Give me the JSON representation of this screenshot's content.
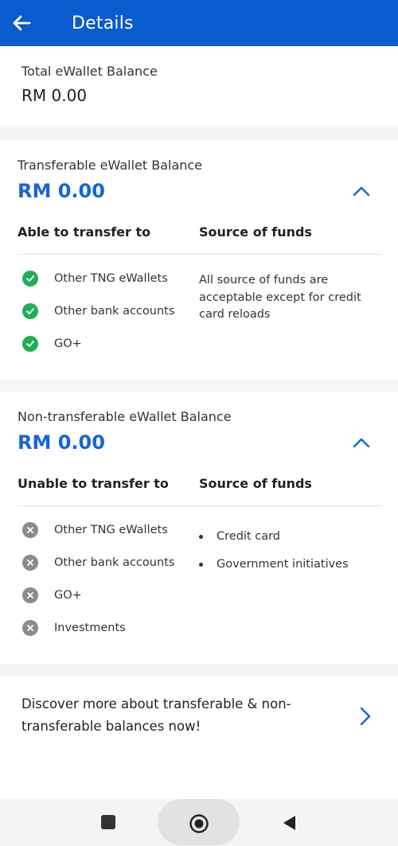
{
  "header": {
    "title": "Details"
  },
  "total": {
    "label": "Total eWallet Balance",
    "value": "RM 0.00"
  },
  "transferable": {
    "label": "Transferable eWallet Balance",
    "amount": "RM 0.00",
    "col_left": "Able to transfer to",
    "col_right": "Source of funds",
    "items": [
      "Other TNG eWallets",
      "Other bank accounts",
      "GO+"
    ],
    "funds_note": "All source of funds are acceptable except for credit card reloads"
  },
  "non_transferable": {
    "label": "Non-transferable eWallet Balance",
    "amount": "RM 0.00",
    "col_left": "Unable to transfer to",
    "col_right": "Source of funds",
    "items": [
      "Other TNG eWallets",
      "Other bank accounts",
      "GO+",
      "Investments"
    ],
    "sources": [
      "Credit card",
      "Government initiatives"
    ]
  },
  "discover": {
    "text": "Discover more about transferable & non-transferable balances now!"
  },
  "colors": {
    "primary": "#0a5bd0",
    "amount": "#1465d8",
    "check": "#1db055",
    "cross": "#8b8b8f"
  },
  "icons": [
    "back-arrow-icon",
    "chevron-up-icon",
    "check-circle-icon",
    "cross-circle-icon",
    "chevron-right-icon",
    "recent-apps-icon",
    "home-icon",
    "back-triangle-icon"
  ]
}
